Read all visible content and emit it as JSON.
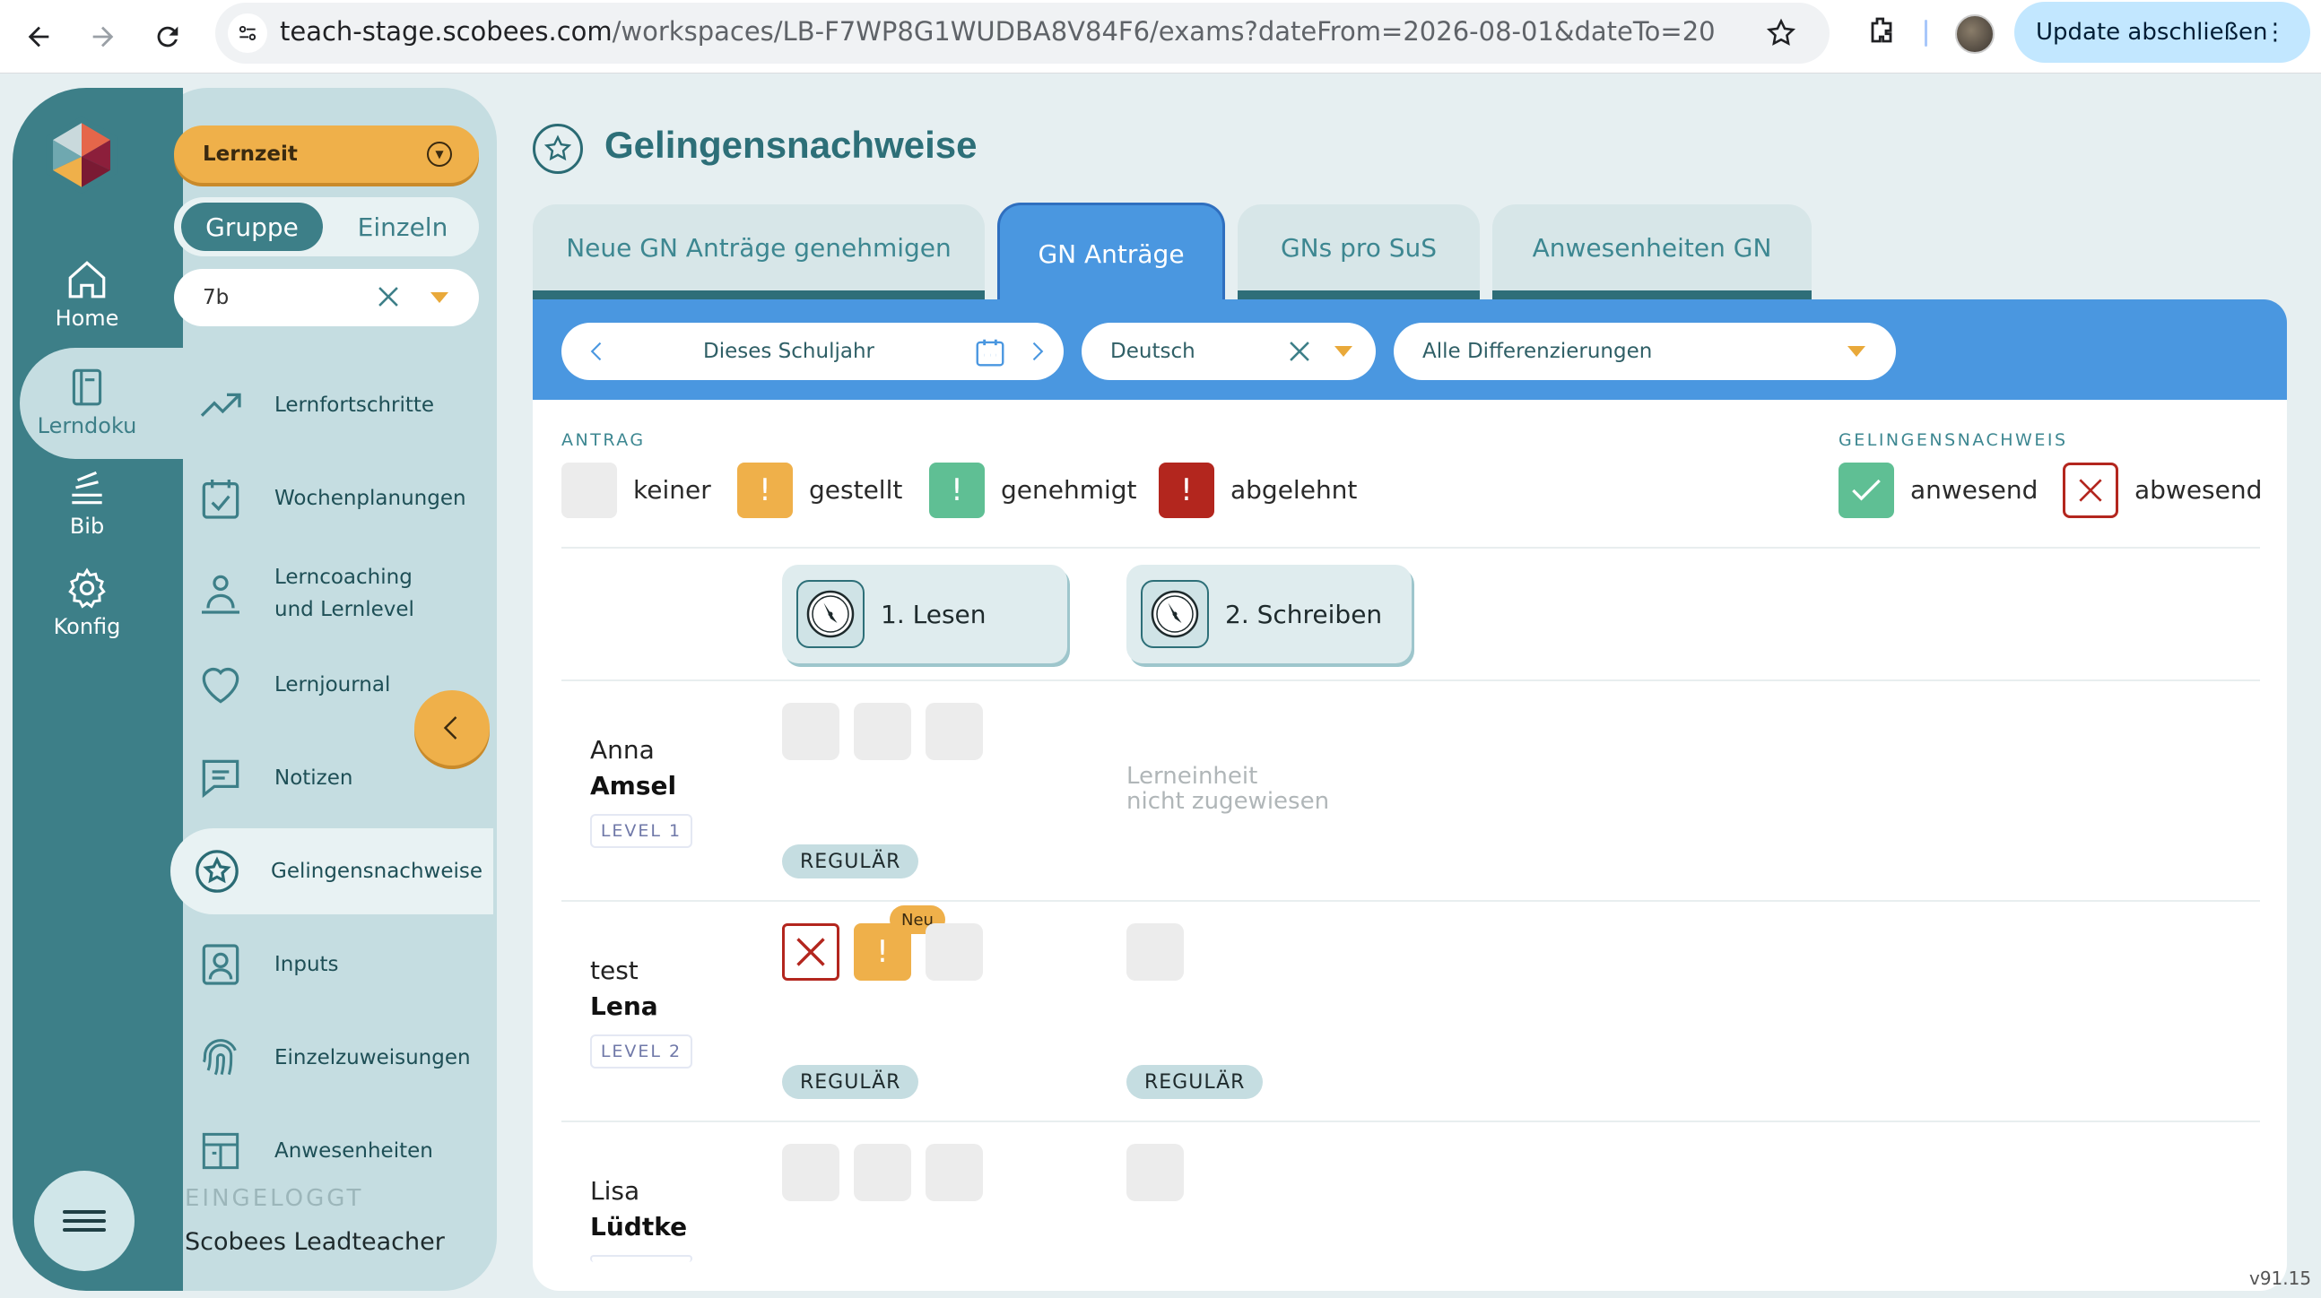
{
  "browser": {
    "url_host": "teach-stage.scobees.com",
    "url_path": "/workspaces/LB-F7WP8G1WUDBA8V84F6/exams?dateFrom=2026-08-01&dateTo=2027-07-31...",
    "update_button": "Update abschließen"
  },
  "rail": {
    "items": [
      {
        "label": "Home",
        "icon": "home-icon"
      },
      {
        "label": "Lerndoku",
        "icon": "book-icon"
      },
      {
        "label": "Bib",
        "icon": "library-icon"
      },
      {
        "label": "Konfig",
        "icon": "gear-icon"
      }
    ]
  },
  "sidebar": {
    "mode": "Lernzeit",
    "toggle": [
      "Gruppe",
      "Einzeln"
    ],
    "class_value": "7b",
    "items": [
      {
        "label": "Lernfortschritte"
      },
      {
        "label": "Wochenplanungen"
      },
      {
        "label": "Lerncoaching",
        "label2": "und Lernlevel"
      },
      {
        "label": "Lernjournal"
      },
      {
        "label": "Notizen"
      },
      {
        "label": "Gelingensnachweise"
      },
      {
        "label": "Inputs"
      },
      {
        "label": "Einzelzuweisungen"
      },
      {
        "label": "Anwesenheiten"
      }
    ],
    "logged_in_label": "EINGELOGGT",
    "user_name": "Scobees Leadteacher"
  },
  "page": {
    "title": "Gelingensnachweise",
    "tabs": [
      "Neue GN Anträge genehmigen",
      "GN Anträge",
      "GNs pro SuS",
      "Anwesenheiten GN"
    ],
    "active_tab": "GN Anträge"
  },
  "filters": {
    "period": "Dieses Schuljahr",
    "subject": "Deutsch",
    "differentiation": "Alle Differenzierungen"
  },
  "legend": {
    "antrag_header": "ANTRAG",
    "antrag": [
      "keiner",
      "gestellt",
      "genehmigt",
      "abgelehnt"
    ],
    "gn_header": "GELINGENSNACHWEIS",
    "gn": [
      "anwesend",
      "abwesend"
    ]
  },
  "colors": {
    "keiner": "#ececec",
    "gestellt": "#efb04a",
    "genehmigt": "#5fbf94",
    "abgelehnt": "#b3261e",
    "anwesend": "#5fbf94",
    "abwesend": "#b3261e"
  },
  "units": [
    "1. Lesen",
    "2. Schreiben"
  ],
  "students": [
    {
      "first": "Anna",
      "last": "Amsel",
      "level": "LEVEL 1",
      "lesen_badge": "REGULÄR",
      "schreiben_note_1": "Lerneinheit",
      "schreiben_note_2": "nicht zugewiesen"
    },
    {
      "first": "test",
      "last": "Lena",
      "level": "LEVEL 2",
      "lesen_badge": "REGULÄR",
      "schreiben_badge": "REGULÄR",
      "new_badge": "Neu"
    },
    {
      "first": "Lisa",
      "last": "Lüdtke"
    }
  ],
  "version": "v91.15"
}
